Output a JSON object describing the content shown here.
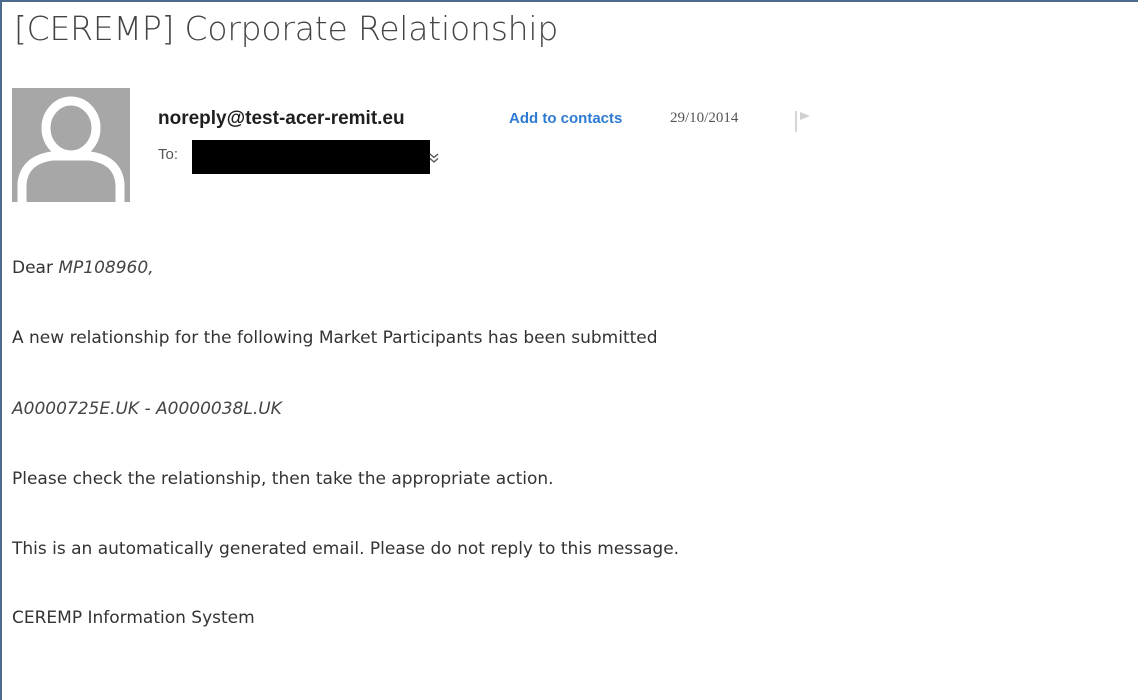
{
  "email": {
    "subject": "[CEREMP] Corporate Relationship",
    "sender": "noreply@test-acer-remit.eu",
    "add_contacts_label": "Add to contacts",
    "date": "29/10/2014",
    "to_label": "To:",
    "avatar_icon": "person-silhouette-icon",
    "flag_icon": "flag-icon",
    "expand_icon": "chevron-down-icon"
  },
  "body": {
    "greeting_prefix": "Dear ",
    "greeting_name": "MP108960,",
    "intro": "A new relationship for the following Market Participants has been submitted",
    "participants": "A0000725E.UK - A0000038L.UK",
    "action": "Please check the relationship, then take the appropriate action.",
    "auto_notice": "This is an automatically generated email. Please do not reply to this message.",
    "signature": "CEREMP Information System"
  },
  "colors": {
    "frame_border": "#4a6a8e",
    "link": "#2d7bd2",
    "avatar_bg": "#a7a7a7",
    "redaction": "#000000"
  }
}
